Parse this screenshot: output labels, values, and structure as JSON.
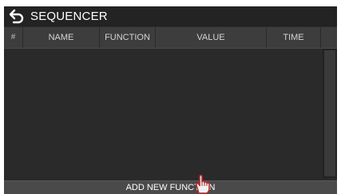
{
  "titlebar": {
    "back_icon": "back-arrow-icon",
    "title": "SEQUENCER"
  },
  "table": {
    "columns": [
      "#",
      "NAME",
      "FUNCTION",
      "VALUE",
      "TIME"
    ],
    "rows": []
  },
  "add_button": {
    "label": "ADD NEW FUNCTION"
  },
  "colors": {
    "background": "#2a2a2a",
    "titlebar": "#232323",
    "header": "#3d3d3d",
    "button": "#4a4a4a",
    "text": "#ffffff"
  }
}
